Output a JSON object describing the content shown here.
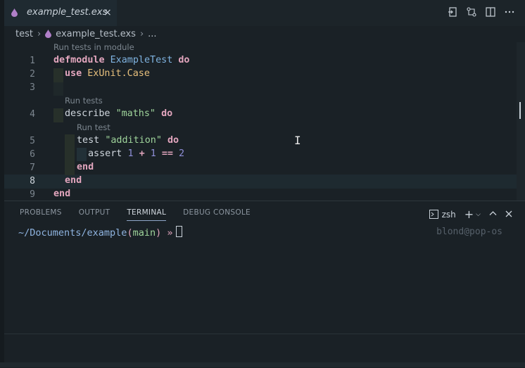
{
  "tab": {
    "filename": "example_test.exs",
    "close": "×",
    "icon": "elixir-drop-icon"
  },
  "actions": [
    "open-preview-icon",
    "source-control-compare-icon",
    "split-editor-icon",
    "more-actions-icon"
  ],
  "breadcrumb": {
    "folder": "test",
    "file": "example_test.exs",
    "more": "..."
  },
  "editor": {
    "codelens": {
      "module": "Run tests in module",
      "describe": "Run tests",
      "test": "Run test"
    },
    "line_numbers": [
      "1",
      "2",
      "3",
      "4",
      "5",
      "6",
      "7",
      "8",
      "9"
    ],
    "active_line": "8"
  },
  "panel": {
    "tabs": [
      "PROBLEMS",
      "OUTPUT",
      "TERMINAL",
      "DEBUG CONSOLE"
    ],
    "active_tab": "TERMINAL",
    "shell": "zsh",
    "prompt_path": "~/Documents/example",
    "prompt_branch": "main",
    "prompt_arrow": "»",
    "host": "blond@pop-os"
  },
  "colors": {
    "keyword": "#e3a6be",
    "module": "#7fb3e0",
    "string": "#9fd49b",
    "number": "#8f8fd8",
    "background": "#1a2126"
  }
}
